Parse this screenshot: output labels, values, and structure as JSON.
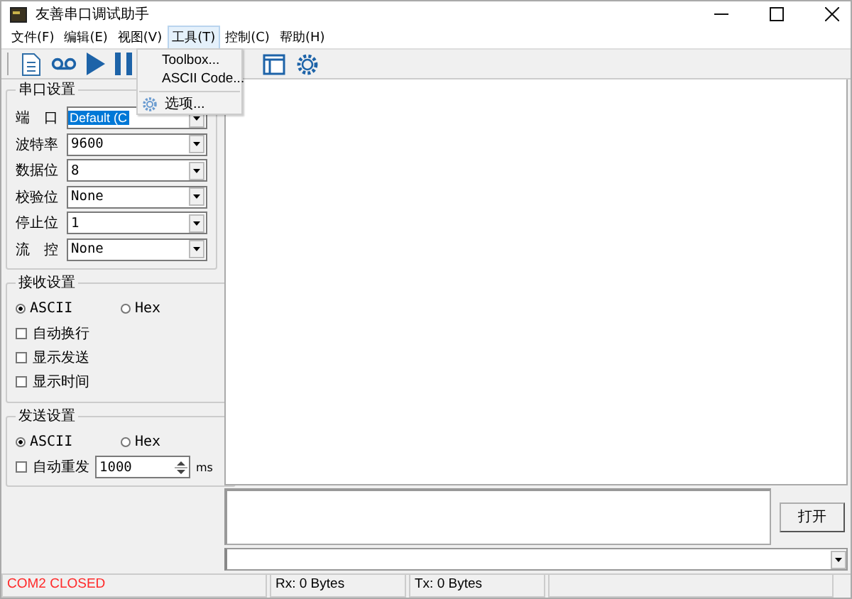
{
  "window": {
    "title": "友善串口调试助手"
  },
  "menu": [
    {
      "label": "文件(F)",
      "selected": false
    },
    {
      "label": "编辑(E)",
      "selected": false
    },
    {
      "label": "视图(V)",
      "selected": false
    },
    {
      "label": "工具(T)",
      "selected": true
    },
    {
      "label": "控制(C)",
      "selected": false
    },
    {
      "label": "帮助(H)",
      "selected": false
    }
  ],
  "dropdown": {
    "items": [
      {
        "kind": "item",
        "label": "Toolbox..."
      },
      {
        "kind": "item",
        "label": "ASCII Code..."
      },
      {
        "kind": "separator"
      },
      {
        "kind": "icon_item",
        "label": "选项..."
      }
    ]
  },
  "serial_settings": {
    "title": "串口设置",
    "fields": [
      {
        "label": "端　口",
        "value": "Default (C",
        "highlighted": true
      },
      {
        "label": "波特率",
        "value": "9600",
        "highlighted": false
      },
      {
        "label": "数据位",
        "value": "8",
        "highlighted": false
      },
      {
        "label": "校验位",
        "value": "None",
        "highlighted": false
      },
      {
        "label": "停止位",
        "value": "1",
        "highlighted": false
      },
      {
        "label": "流　控",
        "value": "None",
        "highlighted": false
      }
    ]
  },
  "receive_settings": {
    "title": "接收设置",
    "format": [
      {
        "label": "ASCII",
        "selected": true
      },
      {
        "label": "Hex",
        "selected": false
      }
    ],
    "options": [
      {
        "label": "自动换行",
        "checked": false
      },
      {
        "label": "显示发送",
        "checked": false
      },
      {
        "label": "显示时间",
        "checked": false
      }
    ]
  },
  "send_settings": {
    "title": "发送设置",
    "format": [
      {
        "label": "ASCII",
        "selected": true
      },
      {
        "label": "Hex",
        "selected": false
      }
    ],
    "auto_repeat": {
      "label": "自动重发",
      "checked": false,
      "value": "1000",
      "unit": "ms"
    }
  },
  "open_button": "打开",
  "status_bar": [
    {
      "kind": "error",
      "text": "COM2 CLOSED"
    },
    {
      "kind": "normal",
      "text": "Rx: 0 Bytes"
    },
    {
      "kind": "normal",
      "text": "Tx: 0 Bytes"
    },
    {
      "kind": "normal"
    }
  ]
}
